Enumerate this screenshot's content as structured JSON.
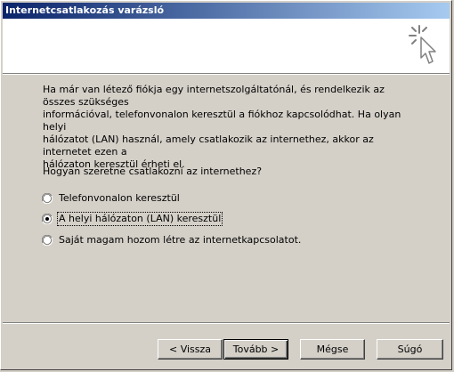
{
  "window": {
    "title": "Internetcsatlakozás varázsló"
  },
  "header": {
    "icon": "wizard-wand-cursor-icon"
  },
  "content": {
    "intro": "Ha már van létező fiókja egy internetszolgáltatónál, és rendelkezik az összes szükséges\ninformációval, telefonvonalon keresztül a fiókhoz kapcsolódhat. Ha olyan helyi\nhálózatot (LAN) használ, amely csatlakozik az  internethez, akkor az internetet ezen a\nhálózaton keresztül érheti el.",
    "question": "Hogyan szeretne csatlakozni az internethez?",
    "options": [
      {
        "label": "Telefonvonalon keresztül",
        "selected": false
      },
      {
        "label": "A helyi hálózaton (LAN) keresztül",
        "selected": true
      },
      {
        "label": "Saját magam hozom létre az internetkapcsolatot.",
        "selected": false
      }
    ]
  },
  "buttons": {
    "back": "< Vissza",
    "next": "Tovább >",
    "cancel": "Mégse",
    "help": "Súgó"
  }
}
